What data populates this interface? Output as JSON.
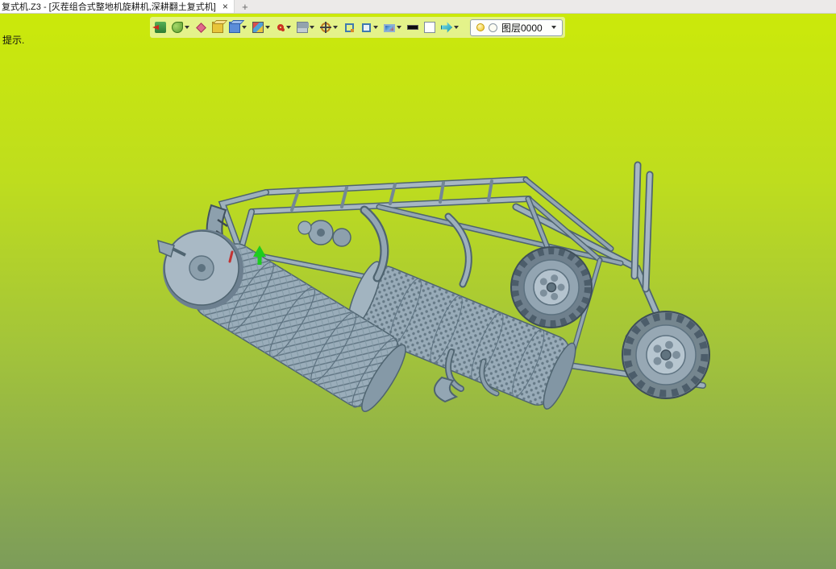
{
  "tabbar": {
    "title": "复式机.Z3 - [灭茬组合式整地机旋耕机,深耕翻土复式机]",
    "close_glyph": "×",
    "new_tab_glyph": "+"
  },
  "hint": {
    "text": "提示."
  },
  "toolbar": {
    "buttons": [
      {
        "name": "exit-button",
        "glyph": "g-exit",
        "caret": false
      },
      {
        "name": "view-orientation-button",
        "glyph": "g-green",
        "caret": true
      },
      {
        "name": "zoom-button",
        "glyph": "g-pink",
        "caret": false
      },
      {
        "name": "pan-button",
        "glyph": "g-yellow-cube",
        "caret": false
      },
      {
        "name": "shade-display-button",
        "glyph": "g-blue-cube",
        "caret": true
      },
      {
        "name": "render-mode-button",
        "glyph": "g-color-cube",
        "caret": true
      },
      {
        "name": "rotate-view-button",
        "glyph": "g-red-wheel",
        "caret": true
      },
      {
        "name": "section-view-button",
        "glyph": "g-gray-cube",
        "caret": true
      },
      {
        "name": "target-point-button",
        "glyph": "g-crosshair",
        "caret": true
      },
      {
        "name": "zoom-window-button",
        "glyph": "g-frame",
        "caret": false
      },
      {
        "name": "fit-window-button",
        "glyph": "g-frame2",
        "caret": true
      },
      {
        "name": "fullscreen-button",
        "glyph": "g-monitor",
        "caret": true
      },
      {
        "name": "background-black-button",
        "glyph": "g-black-bar",
        "caret": false
      },
      {
        "name": "background-white-button",
        "glyph": "g-white-swatch",
        "caret": false
      },
      {
        "name": "view-3d-button",
        "glyph": "g-cyan",
        "caret": true
      }
    ],
    "layer_selector": {
      "value": "图层0000"
    }
  },
  "viewport": {
    "background_top": "#cbe90a",
    "background_bottom": "#7c9c5a",
    "model_color": "#a7b7c3"
  }
}
